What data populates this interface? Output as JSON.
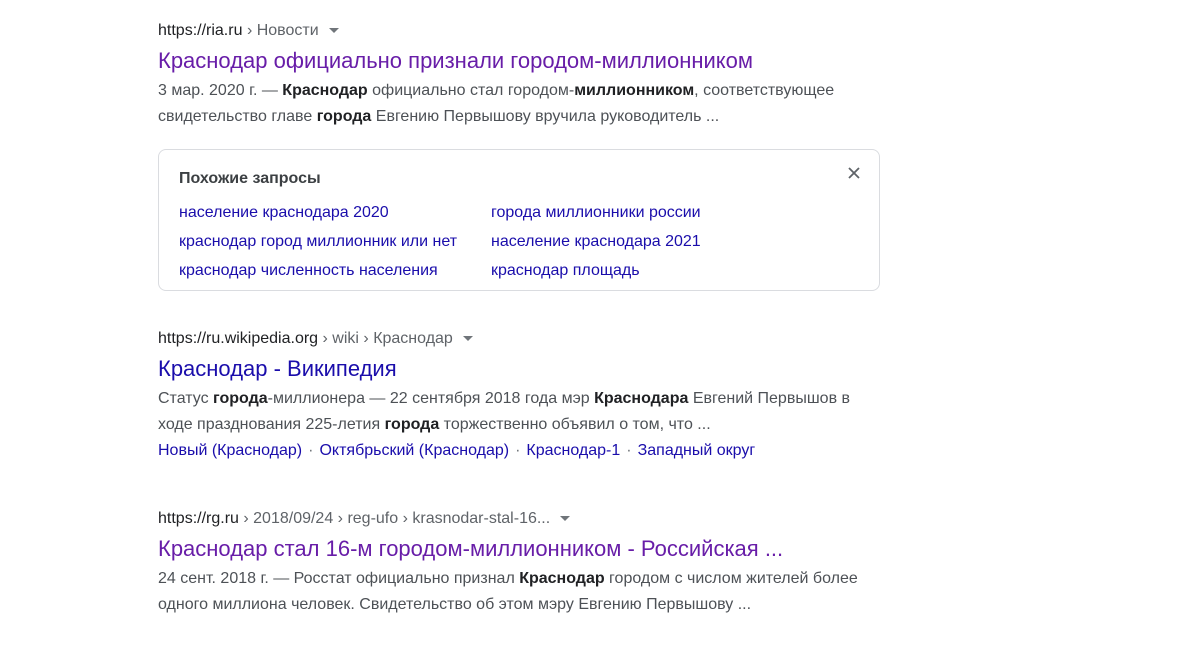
{
  "results": [
    {
      "cite_host": "https://ria.ru",
      "cite_path": "› Новости",
      "title": "Краснодар официально признали городом-миллионником",
      "snippet": [
        {
          "t": "3 мар. 2020 г. — "
        },
        {
          "t": "Краснодар",
          "b": true
        },
        {
          "t": " официально стал городом-"
        },
        {
          "t": "миллионником",
          "b": true
        },
        {
          "t": ", соответствующее свидетельство главе "
        },
        {
          "t": "города",
          "b": true
        },
        {
          "t": " Евгению Первышову вручила руководитель ..."
        }
      ]
    },
    {
      "cite_host": "https://ru.wikipedia.org",
      "cite_path": "› wiki › Краснодар",
      "title": "Краснодар - Википедия",
      "snippet": [
        {
          "t": "Статус "
        },
        {
          "t": "города",
          "b": true
        },
        {
          "t": "-миллионера — 22 сентября 2018 года мэр "
        },
        {
          "t": "Краснодара",
          "b": true
        },
        {
          "t": " Евгений Первышов в ходе празднования 225-летия "
        },
        {
          "t": "города",
          "b": true
        },
        {
          "t": " торжественно объявил о том, что ..."
        }
      ],
      "sitelinks": [
        "Новый (Краснодар)",
        "Октябрьский (Краснодар)",
        "Краснодар-1",
        "Западный округ"
      ]
    },
    {
      "cite_host": "https://rg.ru",
      "cite_path": "› 2018/09/24 › reg-ufo › krasnodar-stal-16...",
      "title": "Краснодар стал 16-м городом-миллионником - Российская ...",
      "snippet": [
        {
          "t": "24 сент. 2018 г. — Росстат официально признал "
        },
        {
          "t": "Краснодар",
          "b": true
        },
        {
          "t": " городом с числом жителей более одного миллиона человек. Свидетельство об этом мэру Евгению Первышову ..."
        }
      ]
    }
  ],
  "related": {
    "title": "Похожие запросы",
    "items": [
      "население краснодара 2020",
      "города миллионники россии",
      "краснодар город миллионник или нет",
      "население краснодара 2021",
      "краснодар численность населения",
      "краснодар площадь"
    ]
  },
  "colors": {
    "visited": "#681da8",
    "link": "#1a0dab",
    "snippet": "#4d5156"
  }
}
